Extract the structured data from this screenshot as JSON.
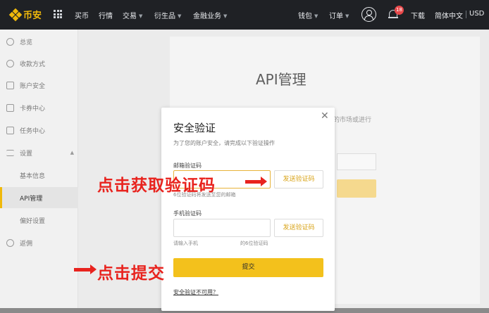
{
  "topbar": {
    "logo": "币安",
    "nav": [
      "买币",
      "行情",
      "交易",
      "衍生品",
      "金融业务"
    ],
    "wallet": "钱包",
    "orders": "订单",
    "notification_count": "18",
    "download": "下载",
    "language": "简体中文",
    "currency": "USD"
  },
  "sidebar": {
    "items": [
      {
        "label": "总览",
        "icon": "person-icon"
      },
      {
        "label": "收款方式",
        "icon": "dollar-icon"
      },
      {
        "label": "账户安全",
        "icon": "shield-icon"
      },
      {
        "label": "卡券中心",
        "icon": "ticket-icon"
      },
      {
        "label": "任务中心",
        "icon": "clipboard-icon"
      },
      {
        "label": "设置",
        "icon": "sliders-icon"
      },
      {
        "label": "基本信息"
      },
      {
        "label": "API管理"
      },
      {
        "label": "偏好设置"
      },
      {
        "label": "返佣",
        "icon": "add-user-icon"
      }
    ]
  },
  "main": {
    "title": "API管理",
    "bg_text": "的市场或进行"
  },
  "modal": {
    "title": "安全验证",
    "subtitle": "为了您的账户安全，请完成以下验证操作",
    "email_label": "邮箱验证码",
    "email_value": "",
    "email_send": "发送验证码",
    "email_hint": "6位验证码将发送至您的邮箱",
    "phone_label": "手机验证码",
    "phone_value": "",
    "phone_send": "发送验证码",
    "phone_hint_a": "请输入手机",
    "phone_hint_b": "的6位验证码",
    "submit": "提交",
    "unavailable": "安全验证不可用？"
  },
  "annotations": {
    "get_code": "点击获取验证码",
    "submit": "点击提交"
  },
  "colors": {
    "brand": "#f0b90b",
    "annotation": "#e8231e",
    "badge": "#e8484a"
  }
}
